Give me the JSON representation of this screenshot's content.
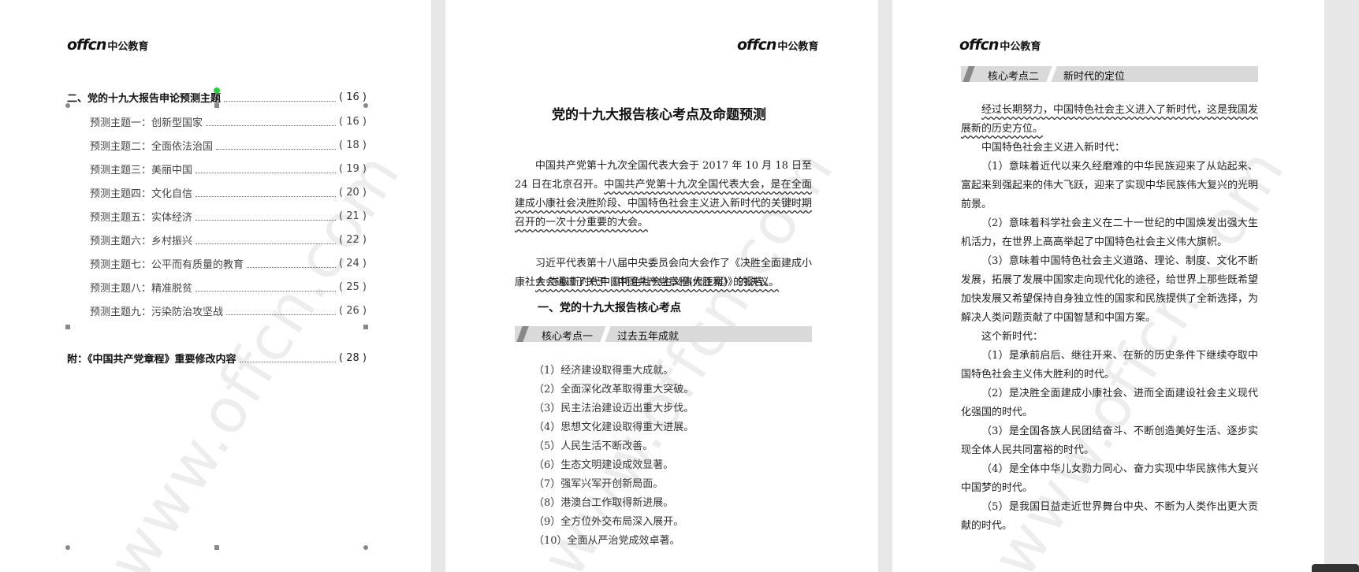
{
  "brand": {
    "logo_en": "offcn",
    "logo_cn": "中公教育"
  },
  "watermark": "www.offcn.com",
  "toc": {
    "main": {
      "title": "二、党的十九大报告申论预测主题",
      "page": "( 16 )"
    },
    "subs": [
      {
        "title": "预测主题一：创新型国家",
        "page": "( 16 )"
      },
      {
        "title": "预测主题二：全面依法治国",
        "page": "( 18 )"
      },
      {
        "title": "预测主题三：美丽中国",
        "page": "( 19 )"
      },
      {
        "title": "预测主题四：文化自信",
        "page": "( 20 )"
      },
      {
        "title": "预测主题五：实体经济",
        "page": "( 21 )"
      },
      {
        "title": "预测主题六：乡村振兴",
        "page": "( 22 )"
      },
      {
        "title": "预测主题七：公平而有质量的教育",
        "page": "( 24 )"
      },
      {
        "title": "预测主题八：精准脱贫",
        "page": "( 25 )"
      },
      {
        "title": "预测主题九：污染防治攻坚战",
        "page": "( 26 )"
      }
    ],
    "appendix": {
      "title": "附：《中国共产党章程》重要修改内容",
      "page": "( 28 )"
    }
  },
  "page2": {
    "title": "党的十九大报告核心考点及命题预测",
    "intro_1_plain": "中国共产党第十九次全国代表大会于 2017 年 10 月 18 日至 24 日在北京召开。",
    "intro_1_marked": "中国共产党第十九次全国代表大会，是在全面建成小康社会决胜阶段、中国特色社会主义进入新时代的关键时期召开的一次十分重要的大会。",
    "intro_2": "习近平代表第十八届中央委员会向大会作了《决胜全面建成小康社会 夺取新时代中国特色社会主义伟大胜利》的报告。",
    "intro_3": "大会通过了关于《中国共产党章程(修正案)》的决议。",
    "section_heading": "一、党的十九大报告核心考点",
    "bar_label": "核心考点一",
    "bar_title": "过去五年成就",
    "items": [
      "（1）经济建设取得重大成就。",
      "（2）全面深化改革取得重大突破。",
      "（3）民主法治建设迈出重大步伐。",
      "（4）思想文化建设取得重大进展。",
      "（5）人民生活不断改善。",
      "（6）生态文明建设成效显著。",
      "（7）强军兴军开创新局面。",
      "（8）港澳台工作取得新进展。",
      "（9）全方位外交布局深入展开。",
      "（10）全面从严治党成效卓著。"
    ]
  },
  "page3": {
    "bar_label": "核心考点二",
    "bar_title": "新时代的定位",
    "lead_marked": "经过长期努力，中国特色社会主义进入了新时代，这是我国发展新的历史方位。",
    "sub_1": "中国特色社会主义进入新时代：",
    "p1": "（1）意味着近代以来久经磨难的中华民族迎来了从站起来、富起来到强起来的伟大飞跃，迎来了实现中华民族伟大复兴的光明前景。",
    "p2": "（2）意味着科学社会主义在二十一世纪的中国焕发出强大生机活力，在世界上高高举起了中国特色社会主义伟大旗帜。",
    "p3": "（3）意味着中国特色社会主义道路、理论、制度、文化不断发展，拓展了发展中国家走向现代化的途径，给世界上那些既希望加快发展又希望保持自身独立性的国家和民族提供了全新选择，为解决人类问题贡献了中国智慧和中国方案。",
    "sub_2": "这个新时代：",
    "q1": "（1）是承前启后、继往开来、在新的历史条件下继续夺取中国特色社会主义伟大胜利的时代。",
    "q2": "（2）是决胜全面建成小康社会、进而全面建设社会主义现代化强国的时代。",
    "q3": "（3）是全国各族人民团结奋斗、不断创造美好生活、逐步实现全体人民共同富裕的时代。",
    "q4": "（4）是全体中华儿女勠力同心、奋力实现中华民族伟大复兴中国梦的时代。",
    "q5": "（5）是我国日益走近世界舞台中央、不断为人类作出更大贡献的时代。"
  }
}
